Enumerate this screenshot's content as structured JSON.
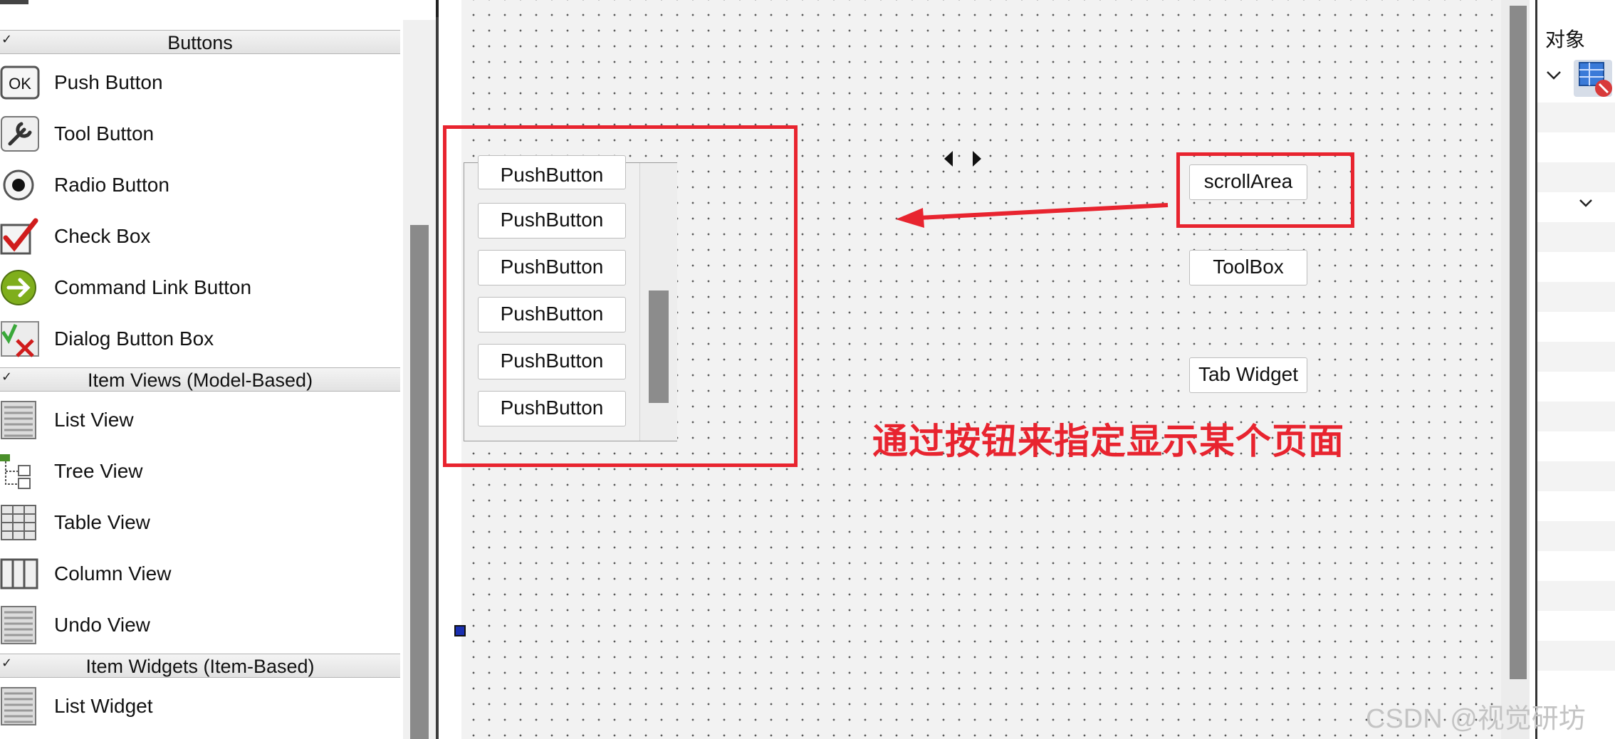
{
  "widget_box": {
    "categories": [
      {
        "label": "Buttons",
        "items": [
          {
            "label": "Push Button",
            "icon": "ok-icon"
          },
          {
            "label": "Tool Button",
            "icon": "wrench-icon"
          },
          {
            "label": "Radio Button",
            "icon": "radio-icon"
          },
          {
            "label": "Check Box",
            "icon": "checkbox-icon"
          },
          {
            "label": "Command Link Button",
            "icon": "arrow-right-icon"
          },
          {
            "label": "Dialog Button Box",
            "icon": "check-cross-icon"
          }
        ]
      },
      {
        "label": "Item Views (Model-Based)",
        "items": [
          {
            "label": "List View",
            "icon": "list-icon"
          },
          {
            "label": "Tree View",
            "icon": "tree-icon"
          },
          {
            "label": "Table View",
            "icon": "table-icon"
          },
          {
            "label": "Column View",
            "icon": "columns-icon"
          },
          {
            "label": "Undo View",
            "icon": "list-icon"
          }
        ]
      },
      {
        "label": "Item Widgets (Item-Based)",
        "items": [
          {
            "label": "List Widget",
            "icon": "list-icon"
          }
        ]
      }
    ]
  },
  "canvas": {
    "scroll_area_buttons": [
      "PushButton",
      "PushButton",
      "PushButton",
      "PushButton",
      "PushButton",
      "PushButton"
    ],
    "side_buttons": {
      "scroll_area": "scrollArea",
      "toolbox": "ToolBox",
      "tab_widget": "Tab Widget"
    },
    "annotation": "通过按钮来指定显示某个页面",
    "annotation_color": "#e8242f",
    "highlight_color": "#e8242f"
  },
  "object_inspector": {
    "title": "对象"
  },
  "watermark": "CSDN @视觉研坊"
}
